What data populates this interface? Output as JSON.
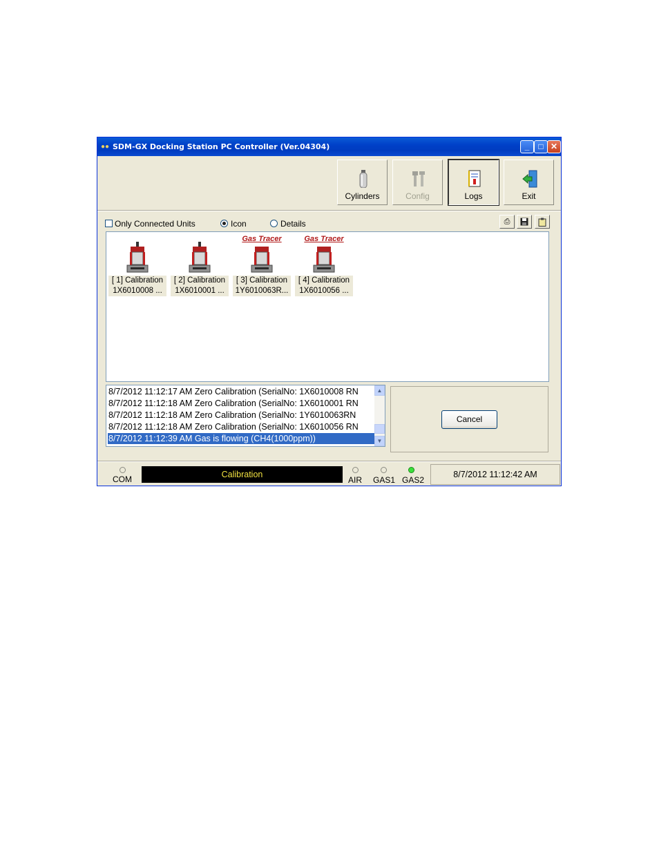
{
  "window": {
    "title": "SDM-GX Docking Station PC Controller (Ver.04304)"
  },
  "toolbar": {
    "cylinders": "Cylinders",
    "config": "Config",
    "logs": "Logs",
    "exit": "Exit"
  },
  "options": {
    "only_connected": "Only Connected Units",
    "only_connected_checked": false,
    "view_icon": "Icon",
    "view_details": "Details",
    "selected_view": "Icon"
  },
  "units": [
    {
      "line1": "[ 1] Calibration",
      "line2": "1X6010008 ...",
      "tag": ""
    },
    {
      "line1": "[ 2] Calibration",
      "line2": "1X6010001 ...",
      "tag": ""
    },
    {
      "line1": "[ 3] Calibration",
      "line2": "1Y6010063R...",
      "tag": "Gas Tracer"
    },
    {
      "line1": "[ 4] Calibration",
      "line2": "1X6010056 ...",
      "tag": "Gas Tracer"
    }
  ],
  "log": [
    "8/7/2012 11:12:17 AM Zero Calibration (SerialNo: 1X6010008 RN",
    "8/7/2012 11:12:18 AM Zero Calibration (SerialNo: 1X6010001 RN",
    "8/7/2012 11:12:18 AM Zero Calibration (SerialNo: 1Y6010063RN",
    "8/7/2012 11:12:18 AM Zero Calibration (SerialNo: 1X6010056 RN",
    "8/7/2012 11:12:39 AM Gas is flowing (CH4(1000ppm))"
  ],
  "cancel_label": "Cancel",
  "status": {
    "com_label": "COM",
    "display_text": "Calibration",
    "air_label": "AIR",
    "gas1_label": "GAS1",
    "gas2_label": "GAS2",
    "gas2_led_color": "#3ae03a",
    "datetime": "8/7/2012 11:12:42 AM"
  }
}
